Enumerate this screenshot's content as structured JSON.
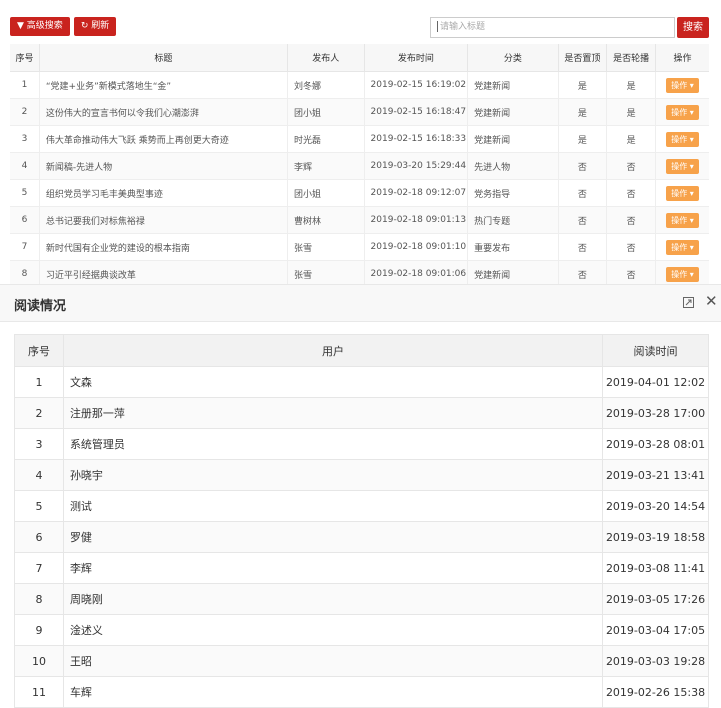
{
  "toolbar": {
    "advanced_search": "高级搜索",
    "refresh": "刷新"
  },
  "search": {
    "placeholder": "请输入标题",
    "button": "搜索"
  },
  "news_table": {
    "headers": [
      "序号",
      "标题",
      "发布人",
      "发布时间",
      "分类",
      "是否置顶",
      "是否轮播",
      "操作"
    ],
    "rows": [
      [
        "1",
        "“党建+业务”新模式落地生“金”",
        "刘冬娜",
        "2019-02-15 16:19:02",
        "党建新闻",
        "是",
        "是",
        "操作"
      ],
      [
        "2",
        "这份伟大的宣言书何以令我们心潮澎湃",
        "团小姐",
        "2019-02-15 16:18:47",
        "党建新闻",
        "是",
        "是",
        "操作"
      ],
      [
        "3",
        "伟大革命推动伟大飞跃 乘势而上再创更大奇迹",
        "时光磊",
        "2019-02-15 16:18:33",
        "党建新闻",
        "是",
        "是",
        "操作"
      ],
      [
        "4",
        "新闻稿-先进人物",
        "李辉",
        "2019-03-20 15:29:44",
        "先进人物",
        "否",
        "否",
        "操作"
      ],
      [
        "5",
        "组织党员学习毛丰美典型事迹",
        "团小姐",
        "2019-02-18 09:12:07",
        "党务指导",
        "否",
        "否",
        "操作"
      ],
      [
        "6",
        "总书记要我们对标焦裕禄",
        "曹树林",
        "2019-02-18 09:01:13",
        "热门专题",
        "否",
        "否",
        "操作"
      ],
      [
        "7",
        "新时代国有企业党的建设的根本指南",
        "张雪",
        "2019-02-18 09:01:10",
        "重要发布",
        "否",
        "否",
        "操作"
      ],
      [
        "8",
        "习近平引经据典谈改革",
        "张雪",
        "2019-02-18 09:01:06",
        "党建新闻",
        "否",
        "否",
        "操作"
      ]
    ]
  },
  "modal": {
    "title": "阅读情况",
    "table": {
      "headers": [
        "序号",
        "用户",
        "阅读时间"
      ],
      "rows": [
        [
          "1",
          "文森",
          "2019-04-01 12:02"
        ],
        [
          "2",
          "注册那一萍",
          "2019-03-28 17:00"
        ],
        [
          "3",
          "系统管理员",
          "2019-03-28 08:01"
        ],
        [
          "4",
          "孙晓宇",
          "2019-03-21 13:41"
        ],
        [
          "5",
          "测试",
          "2019-03-20 14:54"
        ],
        [
          "6",
          "罗健",
          "2019-03-19 18:58"
        ],
        [
          "7",
          "李辉",
          "2019-03-08 11:41"
        ],
        [
          "8",
          "周晓刚",
          "2019-03-05 17:26"
        ],
        [
          "9",
          "淦述义",
          "2019-03-04 17:05"
        ],
        [
          "10",
          "王昭",
          "2019-03-03 19:28"
        ],
        [
          "11",
          "车辉",
          "2019-02-26 15:38"
        ]
      ]
    }
  },
  "colors": {
    "primary_red": "#c9231e",
    "op_orange": "#f7a24a"
  }
}
